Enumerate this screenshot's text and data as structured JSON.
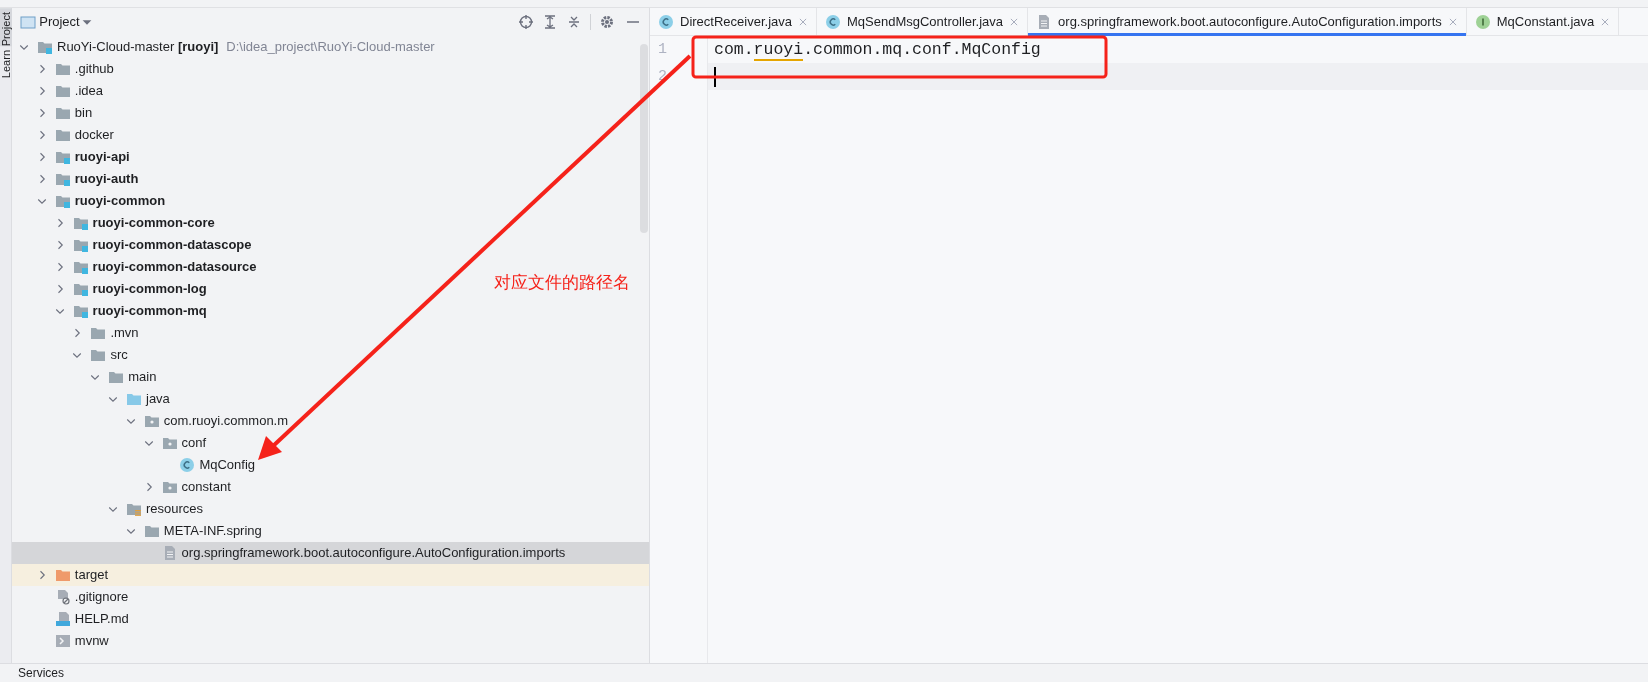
{
  "side_strip": {
    "tabs": [
      {
        "label": "Project",
        "selected": true
      },
      {
        "label": "Learn",
        "selected": false
      }
    ]
  },
  "project_panel": {
    "title": "Project",
    "tree": [
      {
        "label": "RuoYi-Cloud-master **[ruoyi]**",
        "path": "D:\\idea_project\\RuoYi-Cloud-master",
        "kind": "module",
        "expanded": true,
        "selected": false,
        "children": [
          {
            "label": ".github",
            "kind": "folder",
            "expanded": false,
            "selected": false
          },
          {
            "label": ".idea",
            "kind": "folder",
            "expanded": false,
            "selected": false
          },
          {
            "label": "bin",
            "kind": "folder",
            "expanded": false,
            "selected": false
          },
          {
            "label": "docker",
            "kind": "folder",
            "expanded": false,
            "selected": false
          },
          {
            "label": "ruoyi-api",
            "kind": "module",
            "expanded": false,
            "selected": false
          },
          {
            "label": "ruoyi-auth",
            "kind": "module",
            "expanded": false,
            "selected": false
          },
          {
            "label": "ruoyi-common",
            "kind": "module",
            "expanded": true,
            "selected": false,
            "children": [
              {
                "label": "ruoyi-common-core",
                "kind": "module",
                "expanded": false,
                "selected": false
              },
              {
                "label": "ruoyi-common-datascope",
                "kind": "module",
                "expanded": false,
                "selected": false
              },
              {
                "label": "ruoyi-common-datasource",
                "kind": "module",
                "expanded": false,
                "selected": false
              },
              {
                "label": "ruoyi-common-log",
                "kind": "module",
                "expanded": false,
                "selected": false
              },
              {
                "label": "ruoyi-common-mq",
                "kind": "module",
                "expanded": true,
                "selected": false,
                "children": [
                  {
                    "label": ".mvn",
                    "kind": "folder",
                    "expanded": false,
                    "selected": false
                  },
                  {
                    "label": "src",
                    "kind": "folder",
                    "expanded": true,
                    "selected": false,
                    "children": [
                      {
                        "label": "main",
                        "kind": "folder",
                        "expanded": true,
                        "selected": false,
                        "children": [
                          {
                            "label": "java",
                            "kind": "source-root",
                            "expanded": true,
                            "selected": false,
                            "children": [
                              {
                                "label": "com.ruoyi.common.m",
                                "kind": "package",
                                "expanded": true,
                                "selected": false,
                                "children": [
                                  {
                                    "label": "conf",
                                    "kind": "package",
                                    "expanded": true,
                                    "selected": false,
                                    "children": [
                                      {
                                        "label": "MqConfig",
                                        "kind": "class",
                                        "selected": false
                                      }
                                    ]
                                  },
                                  {
                                    "label": "constant",
                                    "kind": "package",
                                    "expanded": false,
                                    "selected": false
                                  }
                                ]
                              }
                            ]
                          },
                          {
                            "label": "resources",
                            "kind": "resources",
                            "expanded": true,
                            "selected": false,
                            "children": [
                              {
                                "label": "META-INF.spring",
                                "kind": "folder",
                                "expanded": true,
                                "selected": false,
                                "children": [
                                  {
                                    "label": "org.springframework.boot.autoconfigure.AutoConfiguration.imports",
                                    "kind": "text-file",
                                    "selected": true
                                  }
                                ]
                              }
                            ]
                          }
                        ]
                      }
                    ]
                  }
                ]
              }
            ]
          },
          {
            "label": "target",
            "kind": "excluded",
            "expanded": false,
            "selected": false
          },
          {
            "label": ".gitignore",
            "kind": "ignore-file",
            "selected": false
          },
          {
            "label": "HELP.md",
            "kind": "markdown",
            "selected": false
          },
          {
            "label": "mvnw",
            "kind": "script",
            "selected": false
          }
        ]
      }
    ]
  },
  "editor": {
    "tabs": [
      {
        "label": "DirectReceiver.java",
        "kind": "class",
        "selected": false
      },
      {
        "label": "MqSendMsgController.java",
        "kind": "class",
        "selected": false
      },
      {
        "label": "org.springframework.boot.autoconfigure.AutoConfiguration.imports",
        "kind": "text-file",
        "selected": true
      },
      {
        "label": "MqConstant.java",
        "kind": "interface",
        "selected": false
      }
    ],
    "lines": [
      {
        "number": "1",
        "current": false,
        "tokens": [
          {
            "text": "com.",
            "typo": false
          },
          {
            "text": "ruoyi",
            "typo": true
          },
          {
            "text": ".common.mq.conf.MqConfig",
            "typo": false
          }
        ]
      },
      {
        "number": "2",
        "current": true
      }
    ]
  },
  "annotation": {
    "text": "对应文件的路径名"
  },
  "bottom_bar": {
    "label": "Services"
  }
}
